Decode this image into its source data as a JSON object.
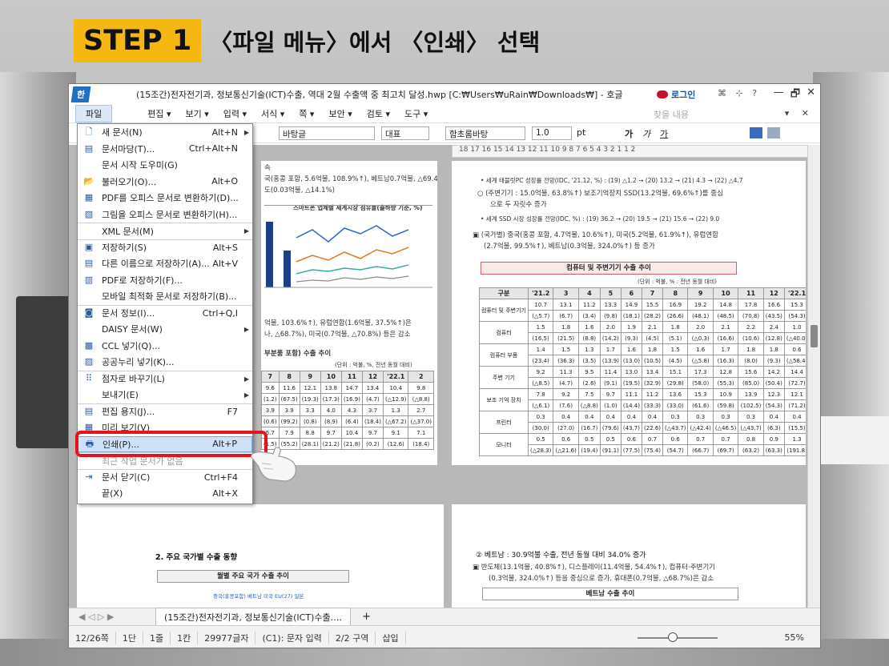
{
  "step": {
    "badge": "STEP 1",
    "instruction": "〈파일 메뉴〉에서 〈인쇄〉 선택"
  },
  "window": {
    "app_logo": "한",
    "title": "(15조간)전자전기과, 정보통신기술(ICT)수출, 역대 2월 수출액 중 최고치 달성.hwp [C:₩Users₩uRain₩Downloads₩] - 호글",
    "login": "로그인",
    "toolbar_icons": "⌘ ⊹ ?",
    "controls": [
      "—",
      "🗗",
      "✕"
    ]
  },
  "menubar": {
    "file": "파일",
    "items": [
      "편집 ▾",
      "보기 ▾",
      "입력 ▾",
      "서식 ▾",
      "쪽 ▾",
      "보안 ▾",
      "검토 ▾",
      "도구 ▾"
    ],
    "search_placeholder": "찾을 내용",
    "right": "▾ ✕"
  },
  "toolbar": {
    "style": "바탕글",
    "style2": "대표",
    "font": "함초롬바탕",
    "size": "1.0",
    "unit": "pt",
    "bold": "가",
    "italic": "가",
    "underline": "가"
  },
  "ruler": "18 17 16 15 14 13 12 11 10 9 8 7 6 5 4 3 2 1 1 2",
  "file_menu": [
    {
      "icon": "🗋",
      "label": "새 문서(N)",
      "shortcut": "Alt+N",
      "arrow": true,
      "sep": false,
      "disabled": false
    },
    {
      "icon": "▤",
      "label": "문서마당(T)...",
      "shortcut": "Ctrl+Alt+N",
      "arrow": false,
      "sep": false,
      "disabled": false
    },
    {
      "icon": "",
      "label": "문서 시작 도우미(G)",
      "shortcut": "",
      "arrow": false,
      "sep": false,
      "disabled": false
    },
    {
      "icon": "📂",
      "label": "불러오기(O)...",
      "shortcut": "Alt+O",
      "arrow": false,
      "sep": false,
      "disabled": false
    },
    {
      "icon": "▦",
      "label": "PDF를 오피스 문서로 변환하기(D)...",
      "shortcut": "",
      "arrow": false,
      "sep": false,
      "disabled": false
    },
    {
      "icon": "▧",
      "label": "그림을 오피스 문서로 변환하기(H)...",
      "shortcut": "",
      "arrow": false,
      "sep": false,
      "disabled": false
    },
    {
      "icon": "",
      "label": "XML 문서(M)",
      "shortcut": "",
      "arrow": true,
      "sep": true,
      "disabled": false
    },
    {
      "icon": "▣",
      "label": "저장하기(S)",
      "shortcut": "Alt+S",
      "arrow": false,
      "sep": true,
      "disabled": false
    },
    {
      "icon": "▤",
      "label": "다른 이름으로 저장하기(A)...",
      "shortcut": "Alt+V",
      "arrow": false,
      "sep": false,
      "disabled": false
    },
    {
      "icon": "▥",
      "label": "PDF로 저장하기(F)...",
      "shortcut": "",
      "arrow": false,
      "sep": false,
      "disabled": false
    },
    {
      "icon": "",
      "label": "모바일 최적화 문서로 저장하기(B)...",
      "shortcut": "",
      "arrow": false,
      "sep": false,
      "disabled": false
    },
    {
      "icon": "◙",
      "label": "문서 정보(I)...",
      "shortcut": "Ctrl+Q,I",
      "arrow": false,
      "sep": true,
      "disabled": false
    },
    {
      "icon": "",
      "label": "DAISY 문서(W)",
      "shortcut": "",
      "arrow": true,
      "sep": false,
      "disabled": false
    },
    {
      "icon": "▩",
      "label": "CCL 넣기(Q)...",
      "shortcut": "",
      "arrow": false,
      "sep": false,
      "disabled": false
    },
    {
      "icon": "▨",
      "label": "공공누리 넣기(K)...",
      "shortcut": "",
      "arrow": false,
      "sep": false,
      "disabled": false
    },
    {
      "icon": "⠿",
      "label": "점자로 바꾸기(L)",
      "shortcut": "",
      "arrow": true,
      "sep": true,
      "disabled": false
    },
    {
      "icon": "",
      "label": "보내기(E)",
      "shortcut": "",
      "arrow": true,
      "sep": false,
      "disabled": false
    },
    {
      "icon": "▤",
      "label": "편집 용지(J)...",
      "shortcut": "F7",
      "arrow": false,
      "sep": true,
      "disabled": false
    },
    {
      "icon": "▦",
      "label": "미리 보기(V)",
      "shortcut": "",
      "arrow": false,
      "sep": false,
      "disabled": false
    },
    {
      "icon": "🖶",
      "label": "인쇄(P)...",
      "shortcut": "Alt+P",
      "arrow": false,
      "sep": false,
      "disabled": false,
      "highlight": true
    },
    {
      "icon": "",
      "label": "최근 작업 문서가 없음",
      "shortcut": "",
      "arrow": false,
      "sep": true,
      "disabled": true
    },
    {
      "icon": "⇥",
      "label": "문서 닫기(C)",
      "shortcut": "Ctrl+F4",
      "arrow": false,
      "sep": true,
      "disabled": false
    },
    {
      "icon": "",
      "label": "끝(X)",
      "shortcut": "Alt+X",
      "arrow": false,
      "sep": false,
      "disabled": false
    }
  ],
  "page1": {
    "line1": "속",
    "line2": "국(홍콩 포함, 5.6억불, 108.9%↑), 베트남0.7억불, △69.4%),",
    "line3": "도(0.03억불, △14.1%)",
    "chart_caption": "스마트폰 업체별 세계시장 점유율(출하량 기준, %)",
    "line4": "억불, 103.6%↑), 유럽연합(1.6억불, 37.5%↑)은",
    "line5": "나, △68.7%), 미국(0.7억불, △70.8%) 등은 감소",
    "table_title": "부분품 포함) 수출 추이",
    "table_unit": "(단위 : 억불, %, 전년 동월 대비)"
  },
  "page2": {
    "bullet1": "• 세계 태블릿PC 성장률 전망(IDC, '21.12, %) : (19) △1.2 → (20) 13.2 → (21) 4.3 → (22) △4.7",
    "bullet2": "○ (주변기기 : 15.0억불, 63.8%↑) 보조기억장치 SSD(13.2억불, 69.6%↑)를 중심",
    "bullet2b": "으로 두 자릿수 증가",
    "bullet3": "• 세계 SSD 시장 성장률 전망(IDC, %) : (19) 36.2 → (20) 19.5 → (21) 15.6 → (22) 9.0",
    "bullet4": "▣ (국가별) 중국(홍콩 포함, 4.7억불, 10.6%↑), 미국(5.2억불, 61.9%↑), 유럽연합",
    "bullet4b": "(2.7억불, 99.5%↑), 베트남(0.3억불, 324.0%↑) 등 증가",
    "table_title": "컴퓨터 및 주변기기 수출 추이",
    "table_unit": "(단위 : 억불, % : 전년 동월 대비)"
  },
  "page3": {
    "heading": "2. 주요 국가별 수출 동향",
    "table_title": "월별 주요 국가 수출 추이",
    "legend": "중국(홍콩포함) 베트남 미국 EU(27) 일본"
  },
  "page4": {
    "heading": "② 베트남 : 30.9억불 수출, 전년 동월 대비 34.0% 증가",
    "line1": "▣ 반도체(13.1억불, 40.8%↑), 디스플레이(11.4억불, 54.4%↑), 컴퓨터·주변기기",
    "line2": "(0.3억불, 324.0%↑) 등을 중심으로 증가, 휴대폰(0.7억불, △68.7%)은 감소",
    "table_title": "베트남 수출 추이"
  },
  "tabbar": {
    "nav": "◀ ◁ ▷ ▶",
    "tab": "(15조간)전자전기과, 정보통신기술(ICT)수출.…",
    "add": "+"
  },
  "statusbar": {
    "page": "12/26쪽",
    "section": "1단",
    "line": "1줄",
    "col": "1칸",
    "chars": "29977글자",
    "mode": "(C1): 문자 입력",
    "area": "2/2 구역",
    "insert": "삽입",
    "zoom": "55%"
  }
}
